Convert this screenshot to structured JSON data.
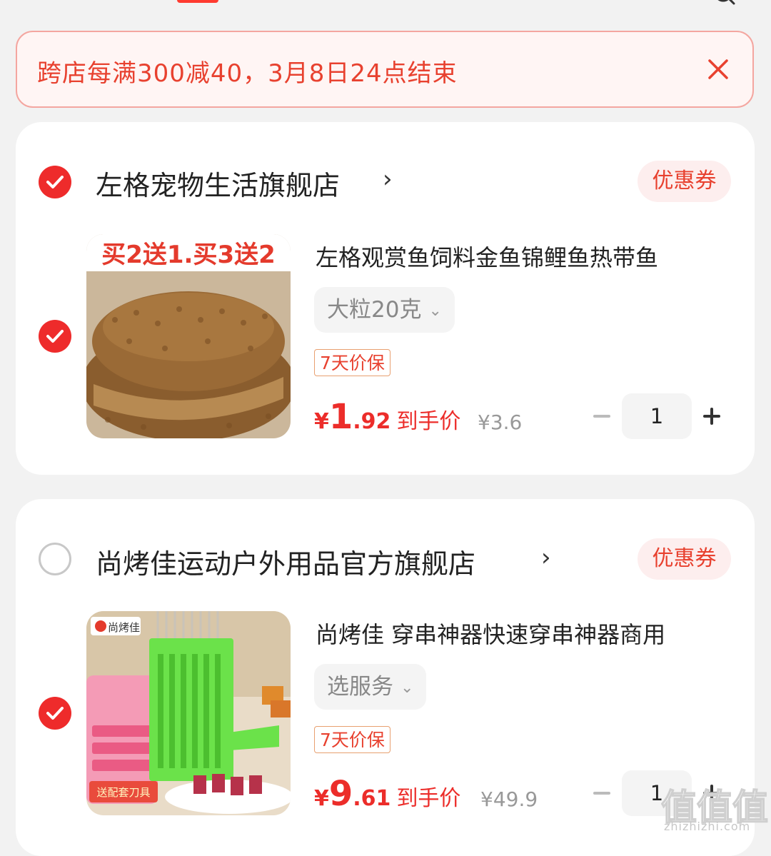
{
  "promo": {
    "text": "跨店每满300减40，3月8日24点结束",
    "close_icon": "close-icon"
  },
  "stores": [
    {
      "name": "左格宠物生活旗舰店",
      "arrow": "›",
      "selected": true,
      "coupon_label": "优惠券",
      "item": {
        "selected": true,
        "image_banner": "买2送1.买3送2",
        "title": "左格观赏鱼饲料金鱼锦鲤鱼热带鱼",
        "sku": "大粒20克",
        "badge": "7天价保",
        "price_currency": "¥",
        "price_int": "1",
        "price_dec": ".92",
        "price_label": "到手价",
        "orig_price": "¥3.6",
        "quantity": "1"
      }
    },
    {
      "name": "尚烤佳运动户外用品官方旗舰店",
      "arrow": "›",
      "selected": false,
      "coupon_label": "优惠券",
      "item": {
        "selected": true,
        "image_brand": "尚烤佳",
        "image_tag": "送配套刀具",
        "title": "尚烤佳 穿串神器快速穿串神器商用",
        "sku": "选服务",
        "badge": "7天价保",
        "price_currency": "¥",
        "price_int": "9",
        "price_dec": ".61",
        "price_label": "到手价",
        "orig_price": "¥49.9",
        "quantity": "1"
      }
    }
  ],
  "watermark": {
    "text": "值值值",
    "site": "zhizhizhi.com"
  },
  "colors": {
    "accent": "#ec2d2a",
    "promo_text": "#e8412f",
    "background": "#f2f2f2"
  }
}
